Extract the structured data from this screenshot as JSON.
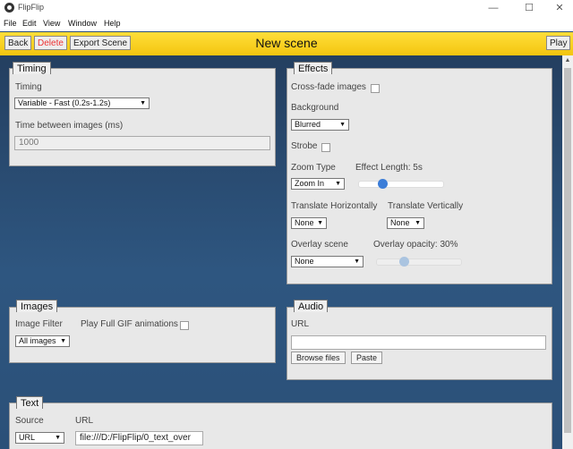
{
  "window": {
    "title": "FlipFlip",
    "minimize": "—",
    "maximize": "☐",
    "close": "✕"
  },
  "menu": [
    "File",
    "Edit",
    "View",
    "Window",
    "Help"
  ],
  "toolbar": {
    "back": "Back",
    "delete": "Delete",
    "export": "Export Scene",
    "title": "New scene",
    "play": "Play"
  },
  "timing": {
    "tab": "Timing",
    "timing_label": "Timing",
    "timing_value": "Variable - Fast (0.2s-1.2s)",
    "time_between_label": "Time between images (ms)",
    "time_between_value": "1000"
  },
  "effects": {
    "tab": "Effects",
    "crossfade_label": "Cross-fade images",
    "background_label": "Background",
    "background_value": "Blurred",
    "strobe_label": "Strobe",
    "zoom_type_label": "Zoom Type",
    "zoom_type_value": "Zoom In",
    "effect_length_label": "Effect Length: 5s",
    "effect_length_fraction": 0.25,
    "translate_h_label": "Translate Horizontally",
    "translate_h_value": "None",
    "translate_v_label": "Translate Vertically",
    "translate_v_value": "None",
    "overlay_scene_label": "Overlay scene",
    "overlay_scene_value": "None",
    "overlay_opacity_label": "Overlay opacity: 30%",
    "overlay_opacity_fraction": 0.3
  },
  "images": {
    "tab": "Images",
    "filter_label": "Image Filter",
    "filter_value": "All images",
    "gif_label": "Play Full GIF animations"
  },
  "audio": {
    "tab": "Audio",
    "url_label": "URL",
    "url_value": "",
    "browse": "Browse files",
    "paste": "Paste"
  },
  "text": {
    "tab": "Text",
    "source_label": "Source",
    "source_value": "URL",
    "url_label": "URL",
    "url_value": "file:///D:/FlipFlip/0_text_over"
  }
}
